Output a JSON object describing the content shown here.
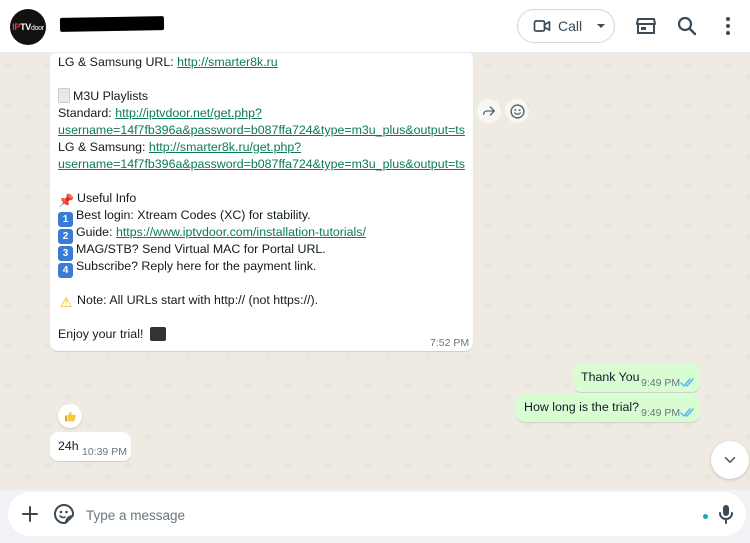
{
  "header": {
    "avatar_logo": "IPTVdoor",
    "call_label": "Call"
  },
  "icons": {
    "video": "video-camera-icon",
    "store": "storefront-icon",
    "search": "search-icon",
    "menu": "kebab-menu-icon"
  },
  "messages": {
    "big": {
      "lines": [
        {
          "text": "LG & Samsung URL: ",
          "link": "http://smarter8k.ru"
        },
        {
          "text": ""
        },
        {
          "emoji": "document",
          "text": "M3U Playlists"
        },
        {
          "text": "Standard: ",
          "link": "http://iptvdoor.net/get.php?"
        },
        {
          "link": "username=14f7fb396a&password=b087ffa724&type=m3u_plus&output=ts"
        },
        {
          "text": "LG & Samsung: ",
          "link": "http://smarter8k.ru/get.php?"
        },
        {
          "link": "username=14f7fb396a&password=b087ffa724&type=m3u_plus&output=ts"
        },
        {
          "text": ""
        },
        {
          "emoji": "pushpin",
          "text": "Useful Info"
        },
        {
          "emoji": "1",
          "text": "Best login: Xtream Codes (XC) for stability."
        },
        {
          "emoji": "2",
          "text": "Guide: ",
          "link": "https://www.iptvdoor.com/installation-tutorials/"
        },
        {
          "emoji": "3",
          "text": "MAG/STB? Send Virtual MAC for Portal URL."
        },
        {
          "emoji": "4",
          "text": "Subscribe? Reply here for the payment link."
        },
        {
          "text": ""
        },
        {
          "emoji": "warning",
          "text": "Note: All URLs start with http:// (not https://)."
        },
        {
          "text": ""
        },
        {
          "text": "Enjoy your trial!",
          "emoji_after": "clapper"
        }
      ],
      "time": "7:52 PM"
    },
    "out1": {
      "text": "Thank You",
      "time": "9:49 PM"
    },
    "out2": {
      "text": "How long is the trial?",
      "time": "9:49 PM"
    },
    "in2": {
      "text": "24h",
      "time": "10:39 PM",
      "reaction": "thumbs-up"
    }
  },
  "composer": {
    "placeholder": "Type a message"
  },
  "colors": {
    "link": "#0b7a57",
    "outgoing_bubble": "#d9fdd3",
    "read_ticks": "#53bdeb"
  }
}
